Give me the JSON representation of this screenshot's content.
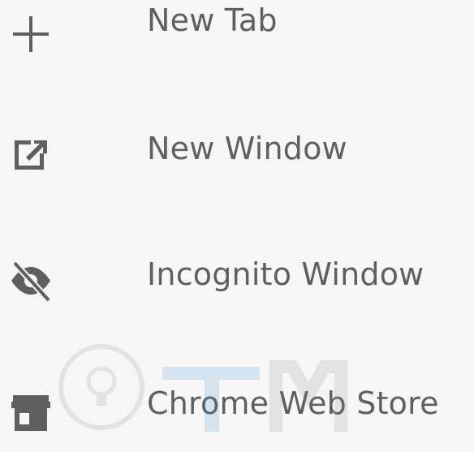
{
  "menu": {
    "items": [
      {
        "label": "New Tab",
        "icon": "plus-icon"
      },
      {
        "label": "New Window",
        "icon": "new-window-icon"
      },
      {
        "label": "Incognito Window",
        "icon": "incognito-icon"
      },
      {
        "label": "Chrome Web Store",
        "icon": "store-icon"
      }
    ]
  },
  "colors": {
    "background": "#f6f6f6",
    "text": "#5f5f5f",
    "icon": "#5f5f5f"
  }
}
